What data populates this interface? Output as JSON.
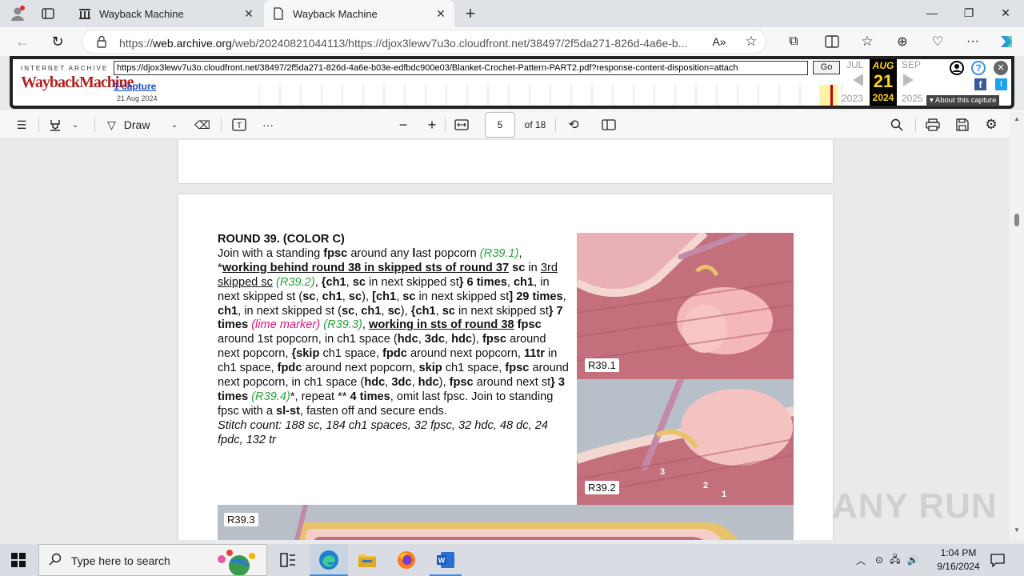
{
  "browser": {
    "tabs": [
      {
        "title": "Wayback Machine",
        "active": false
      },
      {
        "title": "Wayback Machine",
        "active": true
      }
    ],
    "new_tab": "+",
    "url_prefix": "https://",
    "url_host": "web.archive.org",
    "url_rest": "/web/20240821044113/https://djox3lewv7u3o.cloudfront.net/38497/2f5da271-826d-4a6e-b..."
  },
  "wayback": {
    "logo_top": "INTERNET ARCHIVE",
    "logo": "WaybackMachine",
    "url_field": "https://djox3lewv7u3o.cloudfront.net/38497/2f5da271-826d-4a6e-b03e-edfbdc900e03/Blanket-Crochet-Pattern-PART2.pdf?response-content-disposition=attach",
    "go": "Go",
    "captures": "1 capture",
    "capture_date": "21 Aug 2024",
    "months": {
      "prev": "JUL",
      "cur": "AUG",
      "next": "SEP"
    },
    "day": "21",
    "years": {
      "prev": "2023",
      "cur": "2024",
      "next": "2025"
    },
    "about": "▾ About this capture"
  },
  "pdf_toolbar": {
    "draw": "Draw",
    "page": "5",
    "of_pages": "of 18"
  },
  "pattern": {
    "heading": "ROUND 39. (COLOR C)",
    "stitch_count": "Stitch count: 188 sc, 184 ch1 spaces, 32 fpsc, 32 hdc, 48 dc, 24 fpdc, 132 tr"
  },
  "photos": {
    "label1": "R39.1",
    "label2": "R39.2",
    "label3": "R39.3",
    "n3": "3",
    "n2": "2",
    "n1": "1"
  },
  "taskbar": {
    "search_placeholder": "Type here to search",
    "time": "1:04 PM",
    "date": "9/16/2024"
  },
  "watermark": "ANY RUN"
}
